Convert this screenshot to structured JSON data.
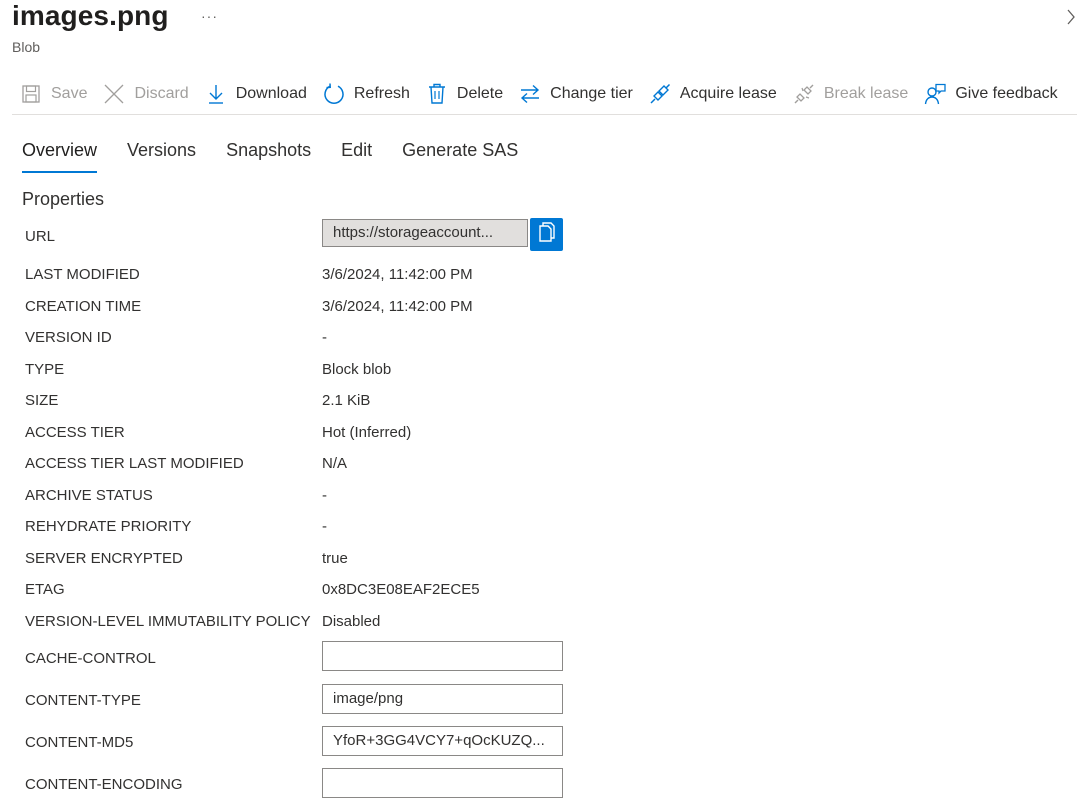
{
  "header": {
    "title": "images.png",
    "subtitle": "Blob",
    "more_label": "···"
  },
  "toolbar": {
    "save": "Save",
    "discard": "Discard",
    "download": "Download",
    "refresh": "Refresh",
    "delete": "Delete",
    "change_tier": "Change tier",
    "acquire_lease": "Acquire lease",
    "break_lease": "Break lease",
    "give_feedback": "Give feedback"
  },
  "tabs": [
    "Overview",
    "Versions",
    "Snapshots",
    "Edit",
    "Generate SAS"
  ],
  "section_title": "Properties",
  "properties": {
    "url_label": "URL",
    "url_value": "https://storageaccount...",
    "last_modified_label": "LAST MODIFIED",
    "last_modified": "3/6/2024, 11:42:00 PM",
    "creation_time_label": "CREATION TIME",
    "creation_time": "3/6/2024, 11:42:00 PM",
    "version_id_label": "VERSION ID",
    "version_id": "-",
    "type_label": "TYPE",
    "type": "Block blob",
    "size_label": "SIZE",
    "size": "2.1 KiB",
    "access_tier_label": "ACCESS TIER",
    "access_tier": "Hot (Inferred)",
    "access_tier_modified_label": "ACCESS TIER LAST MODIFIED",
    "access_tier_modified": "N/A",
    "archive_status_label": "ARCHIVE STATUS",
    "archive_status": "-",
    "rehydrate_priority_label": "REHYDRATE PRIORITY",
    "rehydrate_priority": "-",
    "server_encrypted_label": "SERVER ENCRYPTED",
    "server_encrypted": "true",
    "etag_label": "ETAG",
    "etag": "0x8DC3E08EAF2ECE5",
    "immutability_label": "VERSION-LEVEL IMMUTABILITY POLICY",
    "immutability": "Disabled",
    "cache_control_label": "CACHE-CONTROL",
    "cache_control": "",
    "content_type_label": "CONTENT-TYPE",
    "content_type": "image/png",
    "content_md5_label": "CONTENT-MD5",
    "content_md5": "YfoR+3GG4VCY7+qOcKUZQ...",
    "content_encoding_label": "CONTENT-ENCODING",
    "content_encoding": ""
  },
  "colors": {
    "accent": "#0078d4",
    "text": "#323130",
    "disabled": "#a19f9d"
  }
}
